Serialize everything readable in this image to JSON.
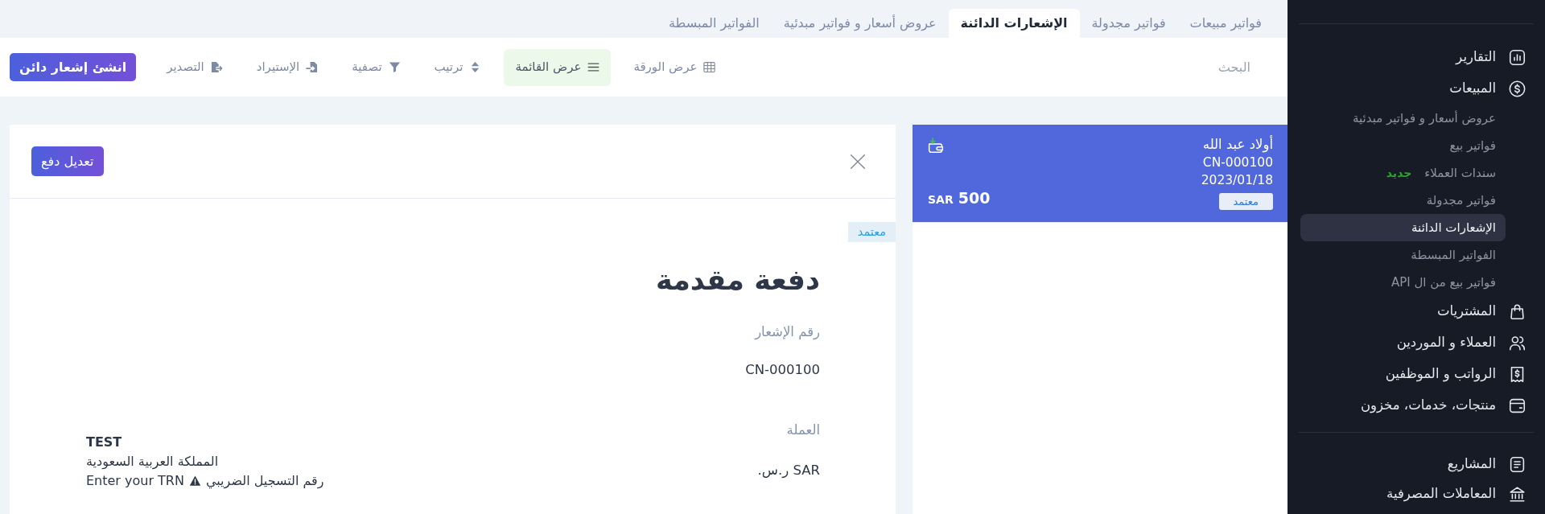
{
  "tabs": [
    {
      "label": "فواتير مبيعات",
      "selected": false
    },
    {
      "label": "فواتير مجدولة",
      "selected": false
    },
    {
      "label": "الإشعارات الدائنة",
      "selected": true
    },
    {
      "label": "عروض أسعار و فواتير مبدئية",
      "selected": false
    },
    {
      "label": "الفواتير المبسطة",
      "selected": false
    }
  ],
  "toolbar": {
    "search": {
      "placeholder": "البحث"
    },
    "views": [
      {
        "label": "عرض الورقة",
        "selected": false
      },
      {
        "label": "عرض القائمة",
        "selected": true
      }
    ],
    "tools": [
      {
        "label": "ترتيب"
      },
      {
        "label": "تصفية"
      },
      {
        "label": "الإستيراد"
      },
      {
        "label": "التصدير"
      }
    ],
    "create_button": "انشئ إشعار دائن"
  },
  "credit_notes": [
    {
      "customer": "أولاد عبد الله",
      "number": "CN-000100",
      "date": "2023/01/18",
      "status": "معتمد",
      "currency": "SAR",
      "amount": "500",
      "selected": true
    }
  ],
  "detail": {
    "edit_button": "تعديل دفع",
    "status": "معتمد",
    "title": "دفعة مقدمة",
    "fields": [
      {
        "label": "رقم الإشعار",
        "value": "CN-000100"
      },
      {
        "label": "العملة",
        "value": "SAR ر.س."
      }
    ],
    "company": {
      "name": "TEST",
      "country": "المملكة العربية السعودية",
      "tax_label": "رقم التسجيل الضريبي",
      "tax_value": "Enter your TRN"
    }
  },
  "sidebar": {
    "sections": [
      {
        "items": [
          {
            "label": "التقارير",
            "selected": false
          },
          {
            "label": "المبيعات",
            "selected": false,
            "children": [
              {
                "label": "عروض أسعار و فواتير مبدئية",
                "selected": false
              },
              {
                "label": "فواتير بيع",
                "selected": false
              },
              {
                "label": "سندات العملاء",
                "badge": "جديد",
                "selected": false
              },
              {
                "label": "فواتير مجدولة",
                "selected": false
              },
              {
                "label": "الإشعارات الدائنة",
                "selected": true
              },
              {
                "label": "الفواتير المبسطة",
                "selected": false
              },
              {
                "label": "فواتير بيع من ال API",
                "selected": false
              }
            ]
          },
          {
            "label": "المشتريات",
            "selected": false
          },
          {
            "label": "العملاء و الموردين",
            "selected": false
          },
          {
            "label": "الرواتب و الموظفين",
            "selected": false
          },
          {
            "label": "منتجات، خدمات، مخزون",
            "selected": false
          }
        ]
      },
      {
        "items": [
          {
            "label": "المشاريع",
            "selected": false
          },
          {
            "label": "المعاملات المصرفية",
            "selected": false
          }
        ]
      }
    ]
  }
}
